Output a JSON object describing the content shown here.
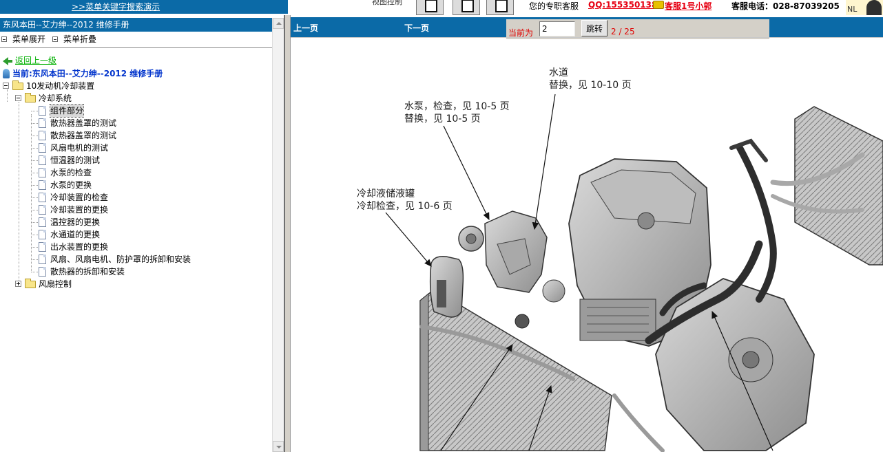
{
  "topbar": {
    "search_demo_link": ">>菜单关键字搜索演示",
    "view_toggle_label": "视图控制",
    "contact_label": "您的专职客服",
    "contact_qq": "QQ:1553501388",
    "contact_service_name": "客服1号小郭",
    "contact_phone": "客服电话：028-87039205",
    "ad_text": "NL"
  },
  "left_panel": {
    "title": "东风本田--艾力绅--2012 维修手册",
    "menu_expand": "菜单展开",
    "menu_collapse": "菜单折叠",
    "back_link": "返回上一级",
    "current_location": "当前:东风本田--艾力绅--2012 维修手册",
    "tree": {
      "root": "10发动机冷却装置",
      "cooling_system": "冷却系统",
      "items": [
        "组件部分",
        "散热器盖罩的测试",
        "散热器盖罩的测试",
        "风扇电机的测试",
        "恒温器的测试",
        "水泵的检查",
        "水泵的更换",
        "冷却装置的检查",
        "冷却装置的更换",
        "温控器的更换",
        "水通道的更换",
        "出水装置的更换",
        "风扇、风扇电机、防护罩的拆卸和安装",
        "散热器的拆卸和安装"
      ],
      "fan_control": "风扇控制"
    }
  },
  "navigation": {
    "prev_page": "上一页",
    "next_page": "下一页",
    "current_label": "当前为",
    "page_input_value": "2",
    "jump_button": "跳转",
    "page_total": "2 / 25"
  },
  "diagram": {
    "callout_water_passage": [
      "水道",
      "替换，见 10-10 页"
    ],
    "callout_water_pump": [
      "水泵，检查，见 10-5 页",
      "替换，见 10-5 页"
    ],
    "callout_reservoir": [
      "冷却液储液罐",
      "冷却检查，见 10-6 页"
    ]
  },
  "colors": {
    "bar_blue": "#0b6aa7",
    "link_red": "#e60012",
    "link_green": "#00b000",
    "current_blue": "#0033cc"
  }
}
